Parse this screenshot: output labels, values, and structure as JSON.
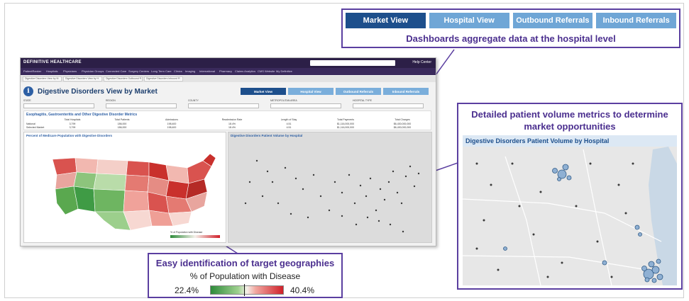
{
  "top_callout": {
    "tabs": [
      "Market View",
      "Hospital View",
      "Outbound Referrals",
      "Inbound Referrals"
    ],
    "active_tab": "Market View",
    "caption": "Dashboards aggregate data at the hospital level"
  },
  "screenshot": {
    "brand": "DEFINITIVE HEALTHCARE",
    "help_label": "Help Center",
    "nav_items": [
      "PatientRanker",
      "Hospitals",
      "Physicians",
      "Physician Groups",
      "Connected Care",
      "Surgery Centers",
      "Long Term Care",
      "Clinics",
      "Imaging",
      "International",
      "Pharmacy",
      "Claims Analytics",
      "CMS Website",
      "My Definitive"
    ],
    "sub_tabs": [
      "Digestive Disorders View by M...",
      "Digestive Disorders View by H...",
      "Digestive Disorders Outbound R...",
      "Digestive Disorders Inbound R..."
    ],
    "title": "Digestive Disorders View by Market",
    "view_tabs": [
      "Market View",
      "Hospital View",
      "Outbound Referrals",
      "Inbound Referrals"
    ],
    "filters": [
      "STATE",
      "REGION",
      "COUNTY",
      "METROPOLITAN AREA",
      "HOSPITAL TYPE"
    ],
    "metrics_title": "Esophagitis, Gastroenteritis and Other Digestive Disorder Metrics",
    "metric_headers": [
      "Total Hospitals",
      "Total Patients",
      "Admissions",
      "Readmission Rate",
      "Length of Stay",
      "Total Payments",
      "Total Charges"
    ],
    "metric_rows": [
      {
        "label": "National",
        "values": [
          "3,799",
          "186,000",
          "198,400",
          "18.4%",
          "4.51",
          "$1,116,000,000",
          "$6,430,000,000"
        ]
      },
      {
        "label": "Selected Market",
        "values": [
          "3,799",
          "186,000",
          "198,400",
          "18.4%",
          "4.51",
          "$1,116,000,000",
          "$6,430,000,000"
        ]
      }
    ],
    "map_panel_title": "Percent of Medicare Population with Digestive Disorders",
    "map_legend_label": "% of Population with Disease",
    "scatter_panel_title": "Digestive Disorders Patient Volume by Hospital"
  },
  "right_callout": {
    "caption": "Detailed patient volume metrics to determine market opportunities",
    "plot_title": "Digestive Disorders Patient Volume by Hospital"
  },
  "bottom_callout": {
    "caption": "Easy identification of target geographies",
    "legend_title": "% of Population with Disease",
    "min_label": "22.4%",
    "max_label": "40.4%"
  },
  "colors": {
    "callout_border": "#5b3fa0",
    "active_tab": "#1d4f8c",
    "inactive_tab": "#6fa6d6",
    "low": "#2e8b3a",
    "high": "#d0202a"
  }
}
